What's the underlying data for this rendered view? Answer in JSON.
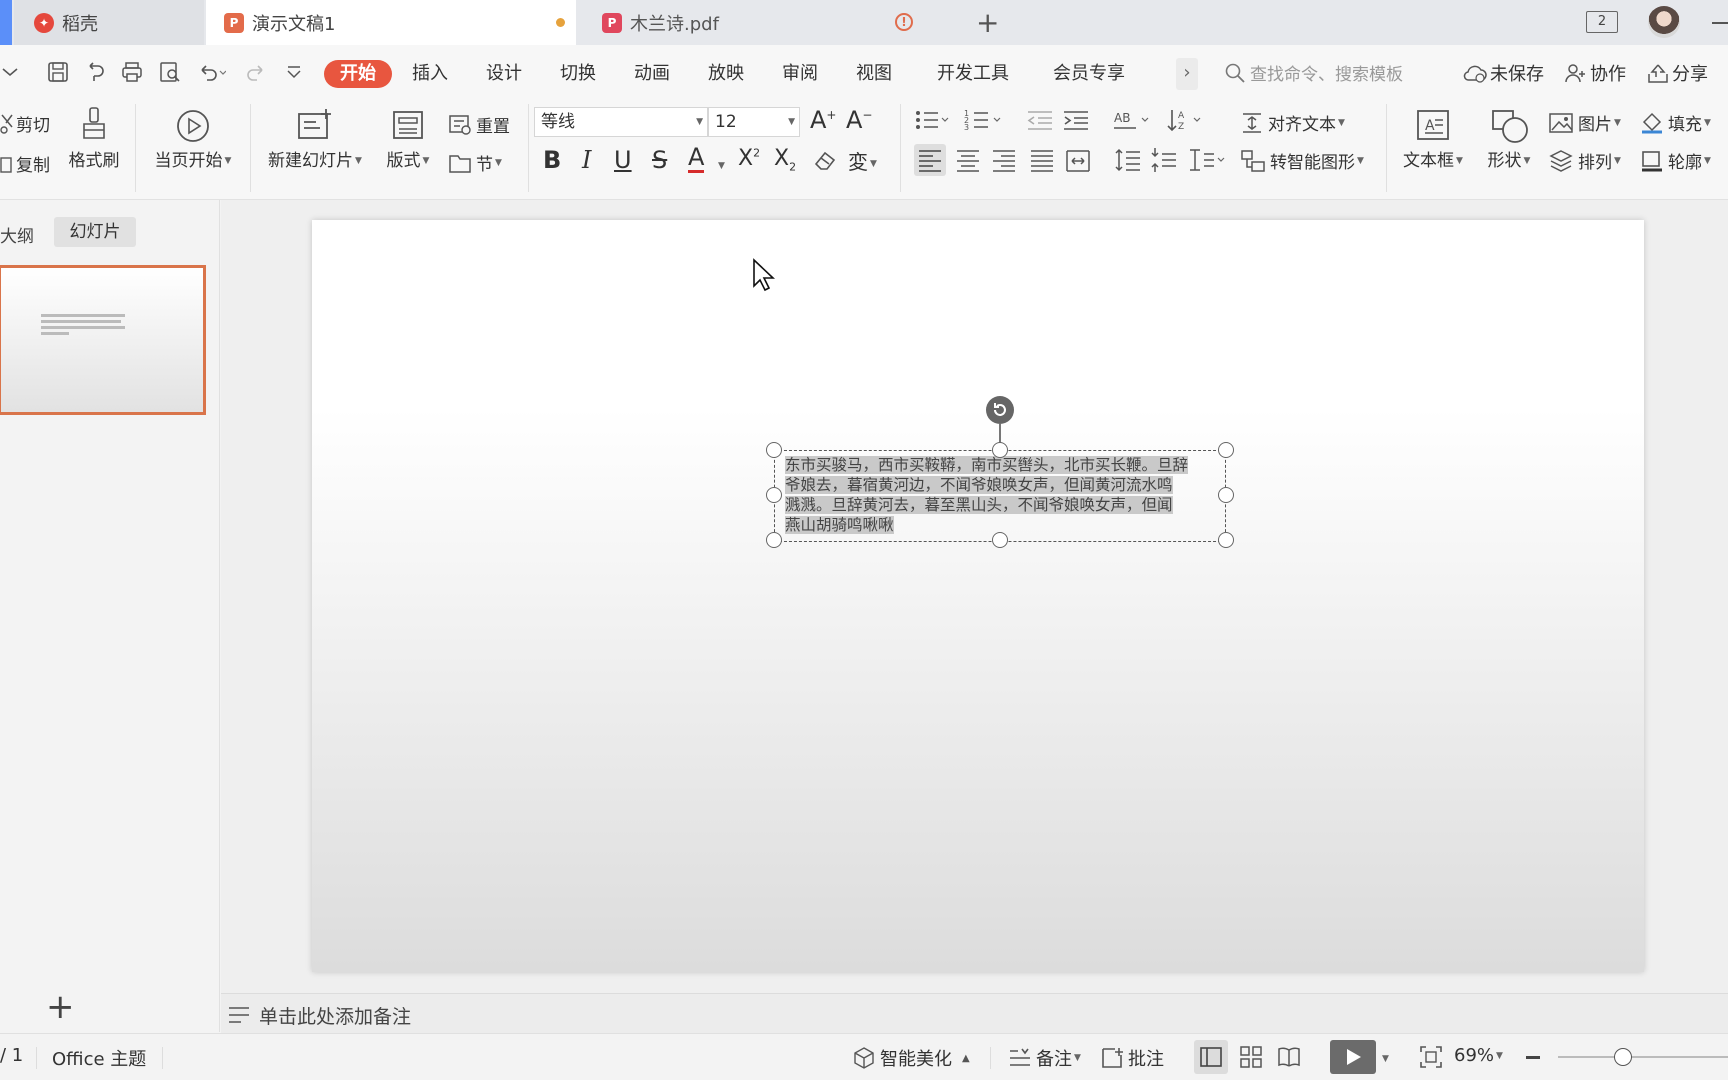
{
  "tabs": [
    {
      "label": "稻壳",
      "icon": "daoke-logo-icon"
    },
    {
      "label": "演示文稿1",
      "icon": "presentation-file-icon",
      "unsaved": true
    },
    {
      "label": "木兰诗.pdf",
      "icon": "pdf-file-icon",
      "warning": true
    }
  ],
  "titlebar": {
    "new_tab": "+",
    "window_count": "2"
  },
  "menu": {
    "items": [
      "开始",
      "插入",
      "设计",
      "切换",
      "动画",
      "放映",
      "审阅",
      "视图",
      "开发工具",
      "会员专享"
    ],
    "active": "开始",
    "more": "›",
    "search_placeholder": "查找命令、搜索模板",
    "unsaved_label": "未保存",
    "collab_label": "协作",
    "share_label": "分享"
  },
  "ribbon": {
    "cut": "剪切",
    "copy": "复制",
    "format_painter": "格式刷",
    "play_from_current": "当页开始",
    "new_slide": "新建幻灯片",
    "layout": "版式",
    "reset": "重置",
    "section": "节",
    "font_name": "等线",
    "font_size": "12",
    "text_align": "对齐文本",
    "convert_smartart": "转智能图形",
    "textbox": "文本框",
    "shape": "形状",
    "picture": "图片",
    "arrange": "排列",
    "fill": "填充",
    "outline": "轮廓"
  },
  "left_panel": {
    "tab_outline": "大纲",
    "tab_slides": "幻灯片",
    "add": "+"
  },
  "slide": {
    "textbox_lines": [
      "东市买骏马，西市买鞍鞯，南市买辔头，北市买长鞭。旦辞",
      "爷娘去，暮宿黄河边，不闻爷娘唤女声，但闻黄河流水鸣",
      "溅溅。旦辞黄河去，暮至黑山头，不闻爷娘唤女声，但闻",
      "燕山胡骑鸣啾啾"
    ]
  },
  "notes": {
    "placeholder": "单击此处添加备注"
  },
  "status": {
    "page": "/ 1",
    "theme": "Office 主题",
    "beautify": "智能美化",
    "notes_btn": "备注",
    "comment_btn": "批注",
    "zoom": "69%"
  },
  "colors": {
    "accent": "#e8563f",
    "selection_border": "#d9744a",
    "pdf_red": "#e0475d",
    "daoke_red": "#e5483d"
  }
}
